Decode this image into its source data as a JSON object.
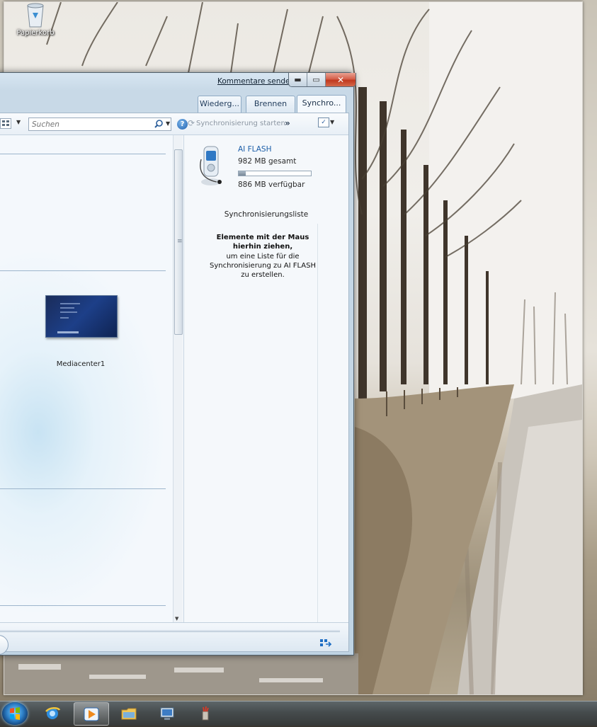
{
  "desktop": {
    "recycle_bin_label": "Papierkorb"
  },
  "window": {
    "feedback_link": "Kommentare senden",
    "tabs": [
      {
        "label": "Wiederg..."
      },
      {
        "label": "Brennen"
      },
      {
        "label": "Synchro...",
        "active": true
      }
    ],
    "toolbar": {
      "search_placeholder": "Suchen",
      "sync_start": "Synchronisierung starten",
      "more_chevron": "»"
    },
    "content": {
      "media_item_label": "Mediacenter1"
    },
    "device": {
      "name": "AI FLASH",
      "total": "982 MB gesamt",
      "free": "886 MB verfügbar",
      "used_fraction": 0.1
    },
    "sync_list": {
      "header": "Synchronisierungsliste",
      "hint_title": "Elemente mit der Maus hierhin ziehen,",
      "hint_text": "um eine Liste für die Synchronisierung zu AI FLASH zu erstellen."
    }
  },
  "taskbar": {
    "items": [
      "start-button",
      "internet-explorer",
      "media-player",
      "windows-explorer",
      "remote-desktop",
      "paint"
    ]
  },
  "colors": {
    "accent": "#1c5ea8",
    "close_button": "#c8442a"
  }
}
